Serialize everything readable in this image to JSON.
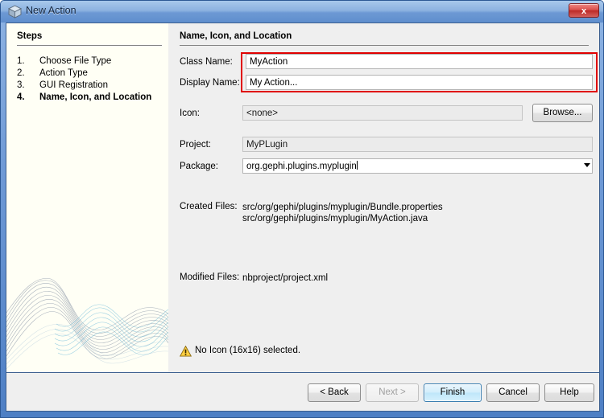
{
  "window": {
    "title": "New Action",
    "title_icon": "cube-icon",
    "close_label": "x",
    "accent_color": "#4e7fc4",
    "annotation_color": "#e00000"
  },
  "steps": {
    "heading": "Steps",
    "items": [
      {
        "num": "1.",
        "label": "Choose File Type",
        "current": false
      },
      {
        "num": "2.",
        "label": "Action Type",
        "current": false
      },
      {
        "num": "3.",
        "label": "GUI Registration",
        "current": false
      },
      {
        "num": "4.",
        "label": "Name, Icon, and Location",
        "current": true
      }
    ]
  },
  "main": {
    "heading": "Name, Icon, and Location",
    "fields": {
      "class_name": {
        "label": "Class Name:",
        "value": "MyAction"
      },
      "display_name": {
        "label": "Display Name:",
        "value": "My Action..."
      },
      "icon": {
        "label": "Icon:",
        "value": "<none>",
        "browse_label": "Browse..."
      },
      "project": {
        "label": "Project:",
        "value": "MyPLugin"
      },
      "package": {
        "label": "Package:",
        "value": "org.gephi.plugins.myplugin"
      }
    },
    "created_files": {
      "label": "Created Files:",
      "value": "src/org/gephi/plugins/myplugin/Bundle.properties\nsrc/org/gephi/plugins/myplugin/MyAction.java"
    },
    "modified_files": {
      "label": "Modified Files:",
      "value": "nbproject/project.xml"
    },
    "warning": {
      "icon": "warning-triangle-icon",
      "text": "No Icon (16x16) selected."
    }
  },
  "buttons": {
    "back": "< Back",
    "next": "Next >",
    "finish": "Finish",
    "cancel": "Cancel",
    "help": "Help"
  }
}
